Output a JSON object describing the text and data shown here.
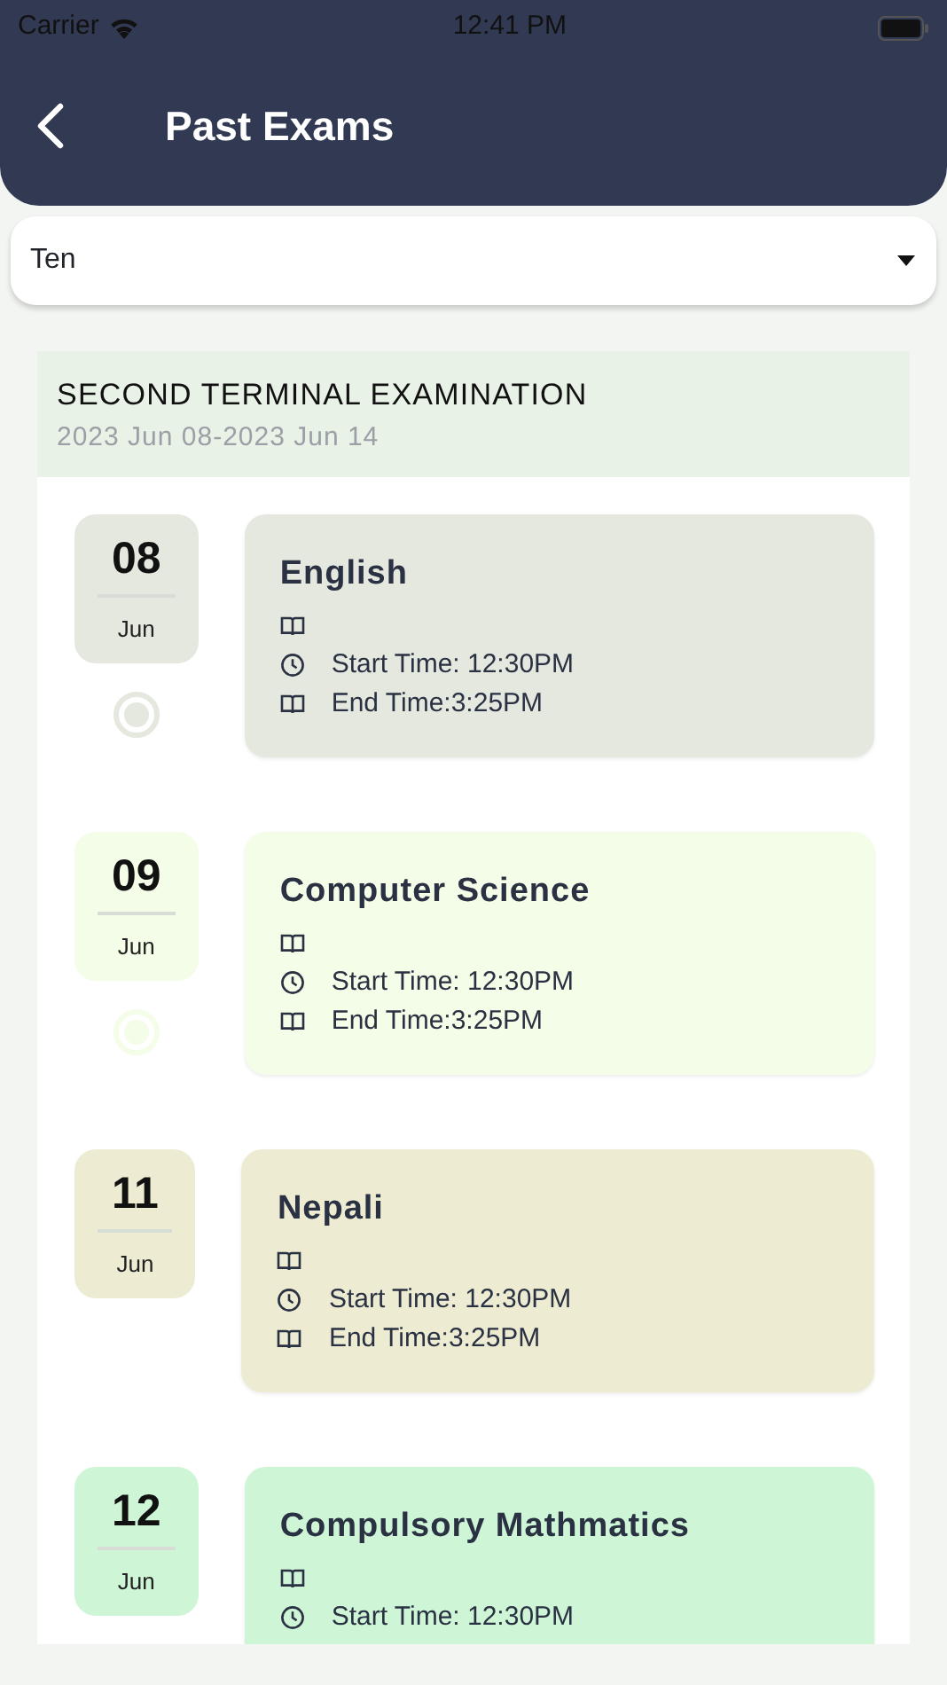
{
  "status_bar": {
    "carrier": "Carrier",
    "time": "12:41 PM"
  },
  "header": {
    "title": "Past Exams"
  },
  "class_select": {
    "value": "Ten"
  },
  "term": {
    "title": "SECOND TERMINAL EXAMINATION",
    "dates": "2023 Jun 08-2023 Jun 14"
  },
  "exams": [
    {
      "day": "08",
      "month": "Jun",
      "subject": "English",
      "start_time": "Start Time: 12:30PM",
      "end_time": "End Time:3:25PM",
      "color": "#e5e8de",
      "dot": true
    },
    {
      "day": "09",
      "month": "Jun",
      "subject": "Computer Science",
      "start_time": "Start Time: 12:30PM",
      "end_time": "End Time:3:25PM",
      "color": "#f4fde7",
      "dot": true
    },
    {
      "day": "11",
      "month": "Jun",
      "subject": "Nepali",
      "start_time": "Start Time: 12:30PM",
      "end_time": "End Time:3:25PM",
      "color": "#edecd2",
      "dot": false
    },
    {
      "day": "12",
      "month": "Jun",
      "subject": "Compulsory Mathmatics",
      "start_time": "Start Time: 12:30PM",
      "color": "#cdf5d6",
      "dot": false
    }
  ]
}
